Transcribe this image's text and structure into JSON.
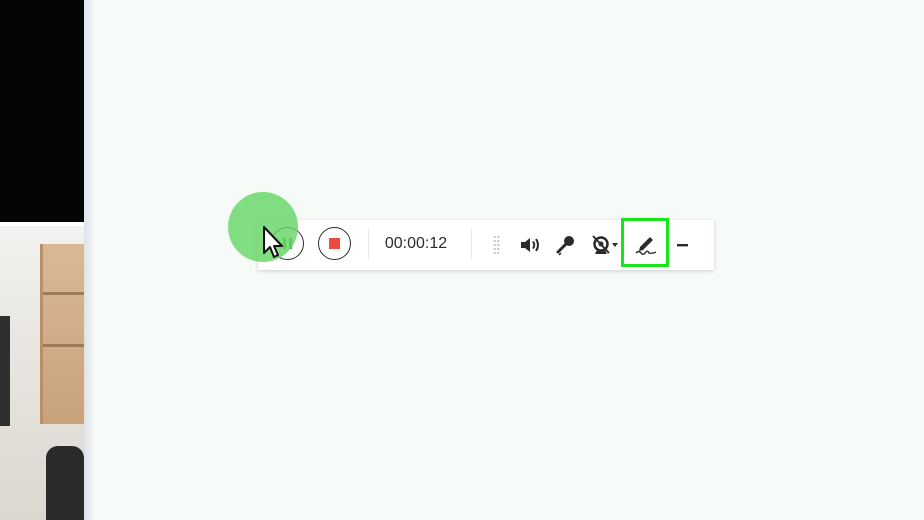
{
  "recorder": {
    "elapsed_time": "00:00:12",
    "state": "recording",
    "buttons": {
      "pause": {
        "icon": "pause-icon",
        "color": "#33a852"
      },
      "stop": {
        "icon": "stop-icon",
        "color": "#ef4a3f"
      },
      "speaker": {
        "icon": "speaker-icon"
      },
      "microphone": {
        "icon": "microphone-icon"
      },
      "webcam": {
        "icon": "webcam-off-icon",
        "has_dropdown": true
      },
      "annotate": {
        "icon": "pen-icon",
        "highlighted": true
      },
      "minimize": {
        "icon": "minimize-icon"
      }
    }
  },
  "overlay": {
    "highlight_color": "#19e51c",
    "click_indicator_color": "#66d666"
  }
}
